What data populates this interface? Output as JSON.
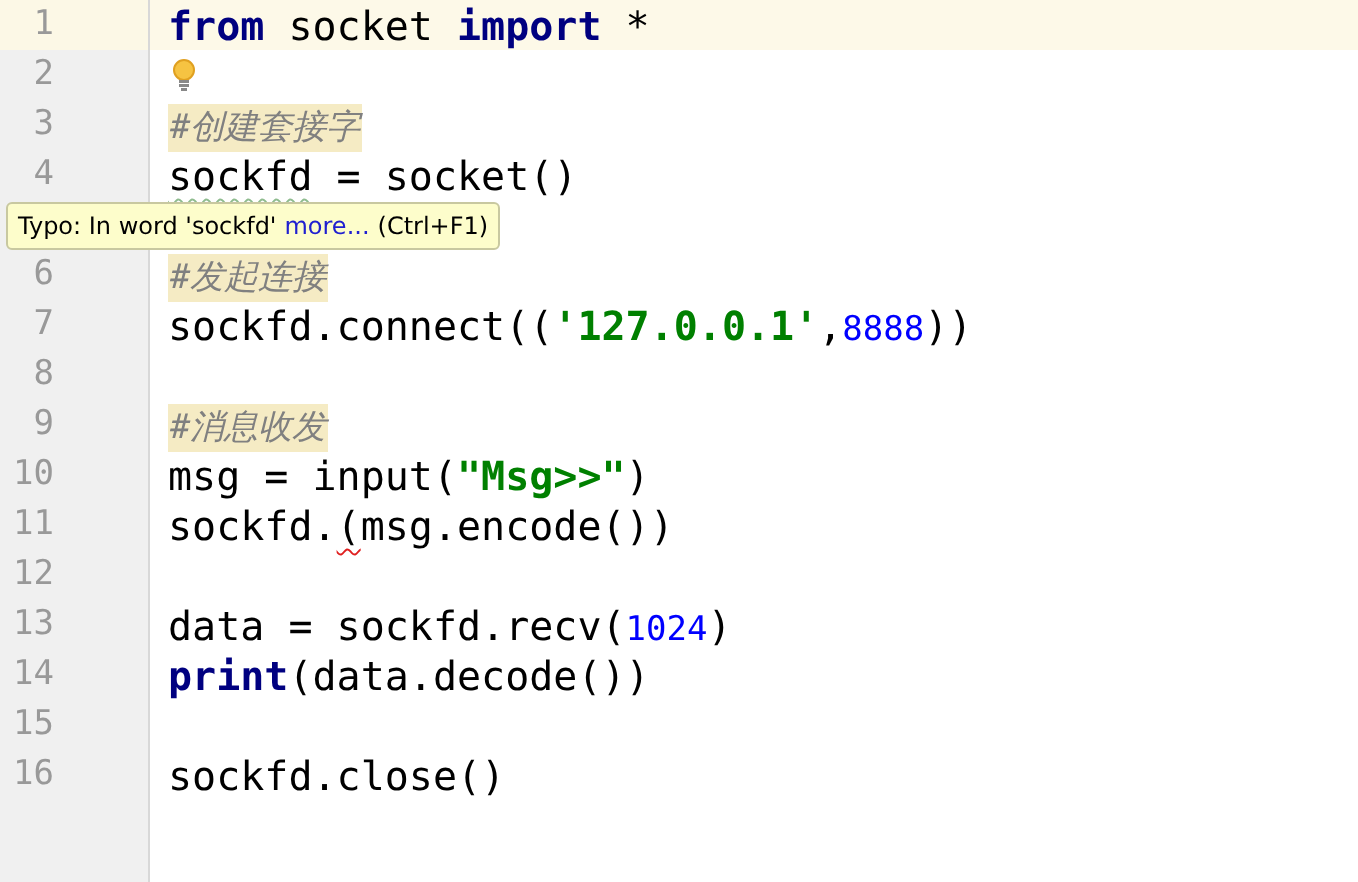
{
  "lines": [
    {
      "number": "1",
      "current": true,
      "tokens": [
        {
          "kind": "keyword",
          "text": "from"
        },
        {
          "kind": "plain",
          "text": " socket "
        },
        {
          "kind": "keyword",
          "text": "import"
        },
        {
          "kind": "plain",
          "text": " *"
        }
      ]
    },
    {
      "number": "2",
      "current": false,
      "bulb": true
    },
    {
      "number": "3",
      "current": false,
      "tokens": [
        {
          "kind": "comment",
          "text": "#创建套接字"
        }
      ]
    },
    {
      "number": "4",
      "current": false,
      "tokens": [
        {
          "kind": "plain",
          "text": "sockfd",
          "typo": true
        },
        {
          "kind": "plain",
          "text": " = socket()"
        }
      ]
    },
    {
      "current": false
    },
    {
      "number": "6",
      "current": false,
      "tokens": [
        {
          "kind": "comment",
          "text": "#发起连接"
        }
      ]
    },
    {
      "number": "7",
      "current": false,
      "tokens": [
        {
          "kind": "plain",
          "text": "sockfd.connect(("
        },
        {
          "kind": "string",
          "text": "'127.0.0.1'"
        },
        {
          "kind": "plain",
          "text": ","
        },
        {
          "kind": "number",
          "text": "8888"
        },
        {
          "kind": "plain",
          "text": "))"
        }
      ]
    },
    {
      "number": "8",
      "current": false
    },
    {
      "number": "9",
      "current": false,
      "tokens": [
        {
          "kind": "comment",
          "text": "#消息收发"
        }
      ]
    },
    {
      "number": "10",
      "current": false,
      "tokens": [
        {
          "kind": "plain",
          "text": "msg = input("
        },
        {
          "kind": "string",
          "text": "\"Msg>>\""
        },
        {
          "kind": "plain",
          "text": ")"
        }
      ]
    },
    {
      "number": "11",
      "current": false,
      "tokens": [
        {
          "kind": "plain",
          "text": "sockfd."
        },
        {
          "kind": "plain",
          "text": "(",
          "error": true
        },
        {
          "kind": "plain",
          "text": "msg.encode())"
        }
      ]
    },
    {
      "number": "12",
      "current": false
    },
    {
      "number": "13",
      "current": false,
      "tokens": [
        {
          "kind": "plain",
          "text": "data = sockfd.recv("
        },
        {
          "kind": "number",
          "text": "1024"
        },
        {
          "kind": "plain",
          "text": ")"
        }
      ]
    },
    {
      "number": "14",
      "current": false,
      "tokens": [
        {
          "kind": "keyword",
          "text": "print"
        },
        {
          "kind": "plain",
          "text": "(data.decode())"
        }
      ]
    },
    {
      "number": "15",
      "current": false
    },
    {
      "number": "16",
      "current": false,
      "tokens": [
        {
          "kind": "plain",
          "text": "sockfd.close()"
        }
      ]
    }
  ],
  "tooltip": {
    "message": "Typo: In word 'sockfd'",
    "link": "more...",
    "shortcut": "(Ctrl+F1)"
  }
}
